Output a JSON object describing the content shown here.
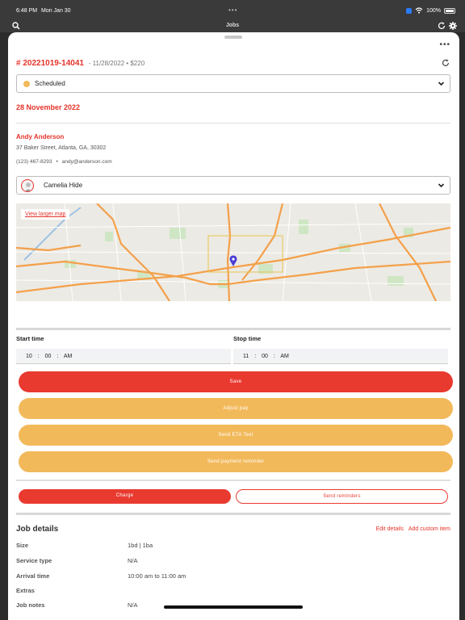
{
  "status_bar": {
    "time": "6:48 PM",
    "date": "Mon Jan 30",
    "battery": "100%"
  },
  "nav": {
    "title": "Jobs"
  },
  "job": {
    "number": "# 20221019-14041",
    "meta": "- 11/28/2022 • $220",
    "status": "Scheduled",
    "date_heading": "28 November 2022"
  },
  "customer": {
    "name": "Andy Anderson",
    "address": "37 Baker Street, Atlanta, GA, 30302",
    "phone": "(123) 467-8293",
    "email": "andy@anderson.com"
  },
  "employee": {
    "name": "Camelia Hide"
  },
  "map": {
    "link_label": "View larger map"
  },
  "times": {
    "start_label": "Start time",
    "start_value": "10 : 00 : AM",
    "stop_label": "Stop time",
    "stop_value": "11 : 00 : AM"
  },
  "buttons": {
    "save": "Save",
    "adjust_pay": "Adjust pay",
    "send_eta": "Send ETA Text",
    "send_payment_reminder": "Send payment reminder",
    "charge": "Charge",
    "send_reminders": "Send reminders"
  },
  "details": {
    "title": "Job details",
    "edit_link": "Edit details",
    "add_item_link": "Add custom item",
    "rows": [
      {
        "key": "Size",
        "value": "1bd | 1ba"
      },
      {
        "key": "Service type",
        "value": "N/A"
      },
      {
        "key": "Arrival time",
        "value": "10:00 am to 11:00 am"
      },
      {
        "key": "Extras",
        "value": ""
      },
      {
        "key": "Job notes",
        "value": "N/A"
      }
    ]
  },
  "colors": {
    "accent": "#e93a30",
    "amber": "#f2b95b",
    "status_dot": "#f2b95b"
  },
  "icons": [
    "search-icon",
    "refresh-icon",
    "gear-icon",
    "more-icon",
    "chevron-down-icon",
    "map-pin-icon",
    "wifi-icon",
    "battery-icon"
  ]
}
